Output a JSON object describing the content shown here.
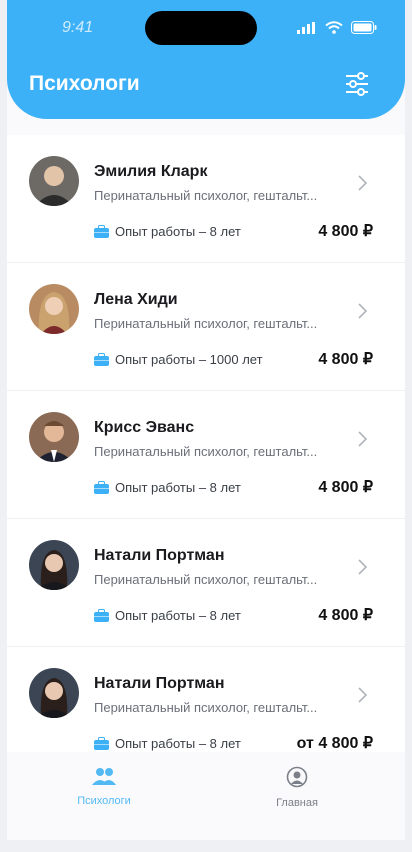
{
  "status": {
    "time": "9:41"
  },
  "header": {
    "title": "Психологи"
  },
  "items": [
    {
      "name": "Эмилия Кларк",
      "spec": "Перинатальный психолог, гештальт...",
      "experience": "Опыт работы – 8 лет",
      "price": "4 800 ₽",
      "avatar_color": "#6d6a66"
    },
    {
      "name": "Лена Хиди",
      "spec": "Перинатальный психолог, гештальт...",
      "experience": "Опыт работы – 1000 лет",
      "price": "4 800 ₽",
      "avatar_color": "#b98b63"
    },
    {
      "name": "Крисс Эванс",
      "spec": "Перинатальный психолог, гештальт...",
      "experience": "Опыт работы – 8 лет",
      "price": "4 800 ₽",
      "avatar_color": "#7a5a48"
    },
    {
      "name": "Натали Портман",
      "spec": "Перинатальный психолог, гештальт...",
      "experience": "Опыт работы – 8 лет",
      "price": "4 800 ₽",
      "avatar_color": "#3b4554"
    },
    {
      "name": "Натали Портман",
      "spec": "Перинатальный психолог, гештальт...",
      "experience": "Опыт работы – 8 лет",
      "price": "от 4 800 ₽",
      "avatar_color": "#3b4554"
    }
  ],
  "tabbar": {
    "tabs": [
      {
        "label": "Психологи",
        "active": true
      },
      {
        "label": "Главная",
        "active": false
      }
    ]
  },
  "colors": {
    "accent": "#3db1f8",
    "tab_active": "#53b9f3",
    "tab_inactive": "#7b7f87"
  }
}
